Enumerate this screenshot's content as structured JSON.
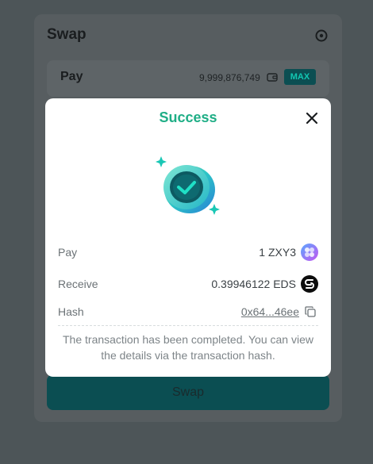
{
  "swap": {
    "title": "Swap",
    "pay_label": "Pay",
    "balance": "9,999,876,749",
    "max_label": "MAX",
    "swap_button": "Swap"
  },
  "modal": {
    "title": "Success",
    "rows": [
      {
        "label": "Pay",
        "value": "1 ZXY3",
        "icon": "zxy3-token-icon"
      },
      {
        "label": "Receive",
        "value": "0.39946122 EDS",
        "icon": "eds-token-icon"
      },
      {
        "label": "Hash",
        "value": "0x64...46ee",
        "icon": "copy-icon"
      }
    ],
    "note": "The transaction has been completed. You can view the details via the transaction hash."
  },
  "colors": {
    "accent": "#1fae86",
    "teal_button": "#0b4e52",
    "max_text": "#12c6b2"
  }
}
